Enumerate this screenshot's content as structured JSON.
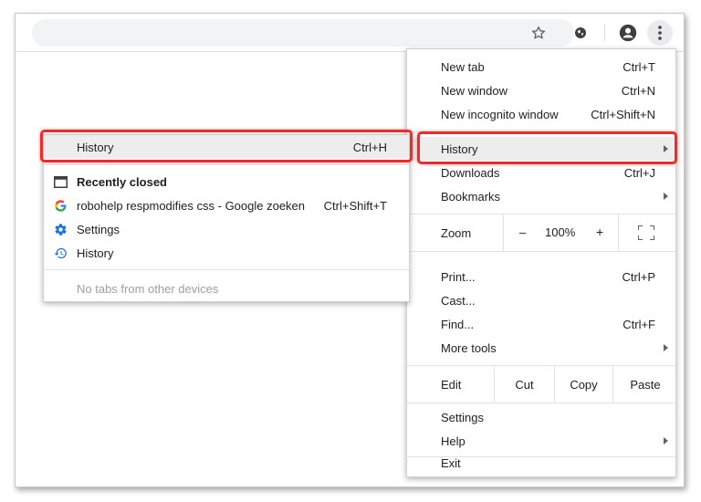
{
  "toolbar": {
    "star_icon": "star-icon",
    "extension_icon": "extension-icon",
    "profile_icon": "account-circle-icon",
    "menu_icon": "more-vertical-icon"
  },
  "menu": {
    "new_tab": {
      "label": "New tab",
      "shortcut": "Ctrl+T"
    },
    "new_window": {
      "label": "New window",
      "shortcut": "Ctrl+N"
    },
    "new_incognito": {
      "label": "New incognito window",
      "shortcut": "Ctrl+Shift+N"
    },
    "history": {
      "label": "History"
    },
    "downloads": {
      "label": "Downloads",
      "shortcut": "Ctrl+J"
    },
    "bookmarks": {
      "label": "Bookmarks"
    },
    "zoom": {
      "label": "Zoom",
      "minus": "–",
      "percent": "100%",
      "plus": "+"
    },
    "print": {
      "label": "Print...",
      "shortcut": "Ctrl+P"
    },
    "cast": {
      "label": "Cast..."
    },
    "find": {
      "label": "Find...",
      "shortcut": "Ctrl+F"
    },
    "more_tools": {
      "label": "More tools"
    },
    "edit": {
      "label": "Edit",
      "cut": "Cut",
      "copy": "Copy",
      "paste": "Paste"
    },
    "settings": {
      "label": "Settings"
    },
    "help": {
      "label": "Help"
    },
    "exit": {
      "label": "Exit"
    }
  },
  "submenu": {
    "history": {
      "label": "History",
      "shortcut": "Ctrl+H"
    },
    "recently_closed": {
      "label": "Recently closed"
    },
    "recent_tab": {
      "label": "robohelp respmodifies css - Google zoeken",
      "shortcut": "Ctrl+Shift+T"
    },
    "settings": {
      "label": "Settings"
    },
    "history_link": {
      "label": "History"
    },
    "no_tabs": {
      "label": "No tabs from other devices"
    }
  },
  "colors": {
    "highlight_red": "#ee2b2b",
    "hover_gray": "#ededed",
    "icon_blue": "#1a73e8"
  }
}
